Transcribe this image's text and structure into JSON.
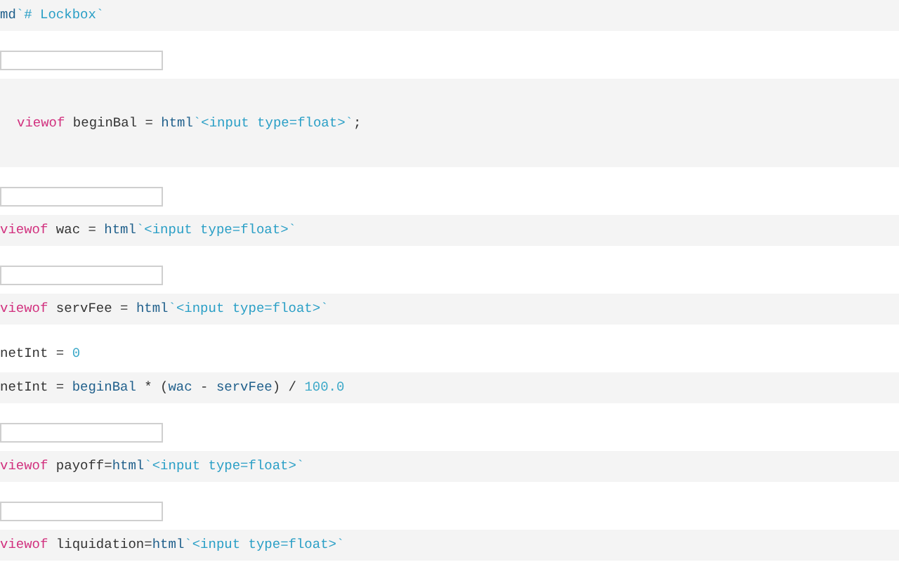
{
  "cells": [
    {
      "kind": "code",
      "tokens": [
        {
          "kind": "fn",
          "text": "md"
        },
        {
          "kind": "str",
          "text": "`# Lockbox`"
        }
      ]
    },
    {
      "kind": "input"
    },
    {
      "kind": "editor",
      "tokens": [
        {
          "kind": "kw",
          "text": "viewof"
        },
        {
          "kind": "plain",
          "text": " beginBal = "
        },
        {
          "kind": "fn",
          "text": "html"
        },
        {
          "kind": "str",
          "text": "`<input type=float>`"
        },
        {
          "kind": "plain",
          "text": ";"
        }
      ]
    },
    {
      "kind": "input"
    },
    {
      "kind": "code",
      "tokens": [
        {
          "kind": "kw",
          "text": "viewof"
        },
        {
          "kind": "plain",
          "text": " wac = "
        },
        {
          "kind": "fn",
          "text": "html"
        },
        {
          "kind": "str",
          "text": "`<input type=float>`"
        }
      ]
    },
    {
      "kind": "input"
    },
    {
      "kind": "code",
      "tokens": [
        {
          "kind": "kw",
          "text": "viewof"
        },
        {
          "kind": "plain",
          "text": " servFee = "
        },
        {
          "kind": "fn",
          "text": "html"
        },
        {
          "kind": "str",
          "text": "`<input type=float>`"
        }
      ]
    },
    {
      "kind": "output",
      "tokens": [
        {
          "kind": "plain",
          "text": "netInt = "
        },
        {
          "kind": "num",
          "text": "0"
        }
      ]
    },
    {
      "kind": "code",
      "tokens": [
        {
          "kind": "plain",
          "text": "netInt = "
        },
        {
          "kind": "fn",
          "text": "beginBal"
        },
        {
          "kind": "plain",
          "text": " * ("
        },
        {
          "kind": "fn",
          "text": "wac"
        },
        {
          "kind": "plain",
          "text": " - "
        },
        {
          "kind": "fn",
          "text": "servFee"
        },
        {
          "kind": "plain",
          "text": ") / "
        },
        {
          "kind": "num",
          "text": "100.0"
        }
      ]
    },
    {
      "kind": "input"
    },
    {
      "kind": "code",
      "tokens": [
        {
          "kind": "kw",
          "text": "viewof"
        },
        {
          "kind": "plain",
          "text": " payoff="
        },
        {
          "kind": "fn",
          "text": "html"
        },
        {
          "kind": "str",
          "text": "`<input type=float>`"
        }
      ]
    },
    {
      "kind": "input"
    },
    {
      "kind": "code",
      "tokens": [
        {
          "kind": "kw",
          "text": "viewof"
        },
        {
          "kind": "plain",
          "text": " liquidation="
        },
        {
          "kind": "fn",
          "text": "html"
        },
        {
          "kind": "str",
          "text": "`<input type=float>`"
        }
      ]
    }
  ]
}
